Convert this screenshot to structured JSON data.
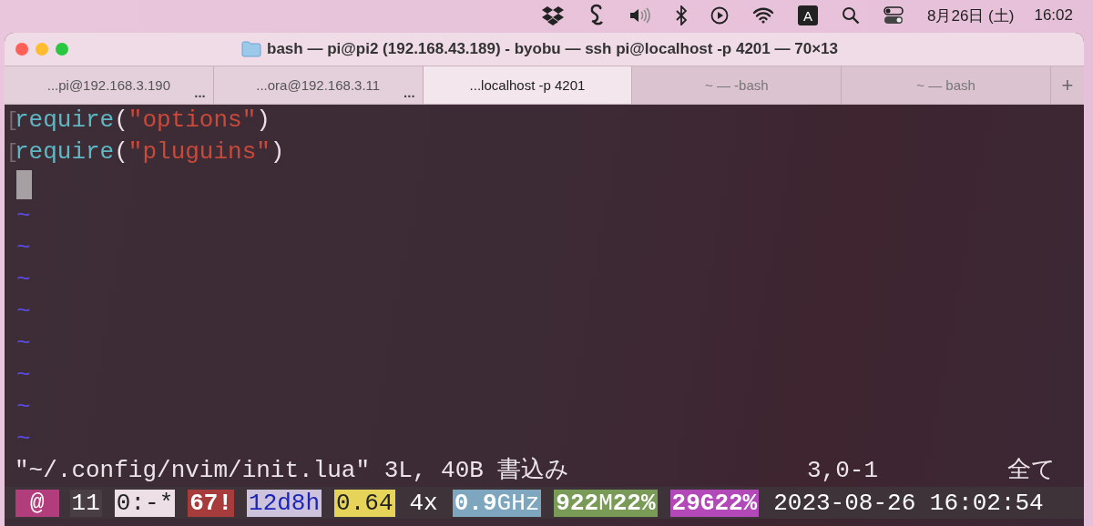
{
  "menu_bar": {
    "input_indicator": "A",
    "date": "8月26日 (土)",
    "time": "16:02"
  },
  "window": {
    "title": "bash — pi@pi2 (192.168.43.189) - byobu — ssh pi@localhost -p 4201 — 70×13"
  },
  "tabs": [
    {
      "label": "...pi@192.168.3.190",
      "selected": false,
      "more": "..."
    },
    {
      "label": "...ora@192.168.3.11",
      "selected": false,
      "more": "..."
    },
    {
      "label": "...localhost -p 4201",
      "selected": true
    },
    {
      "label": "~ — -bash",
      "selected": false
    },
    {
      "label": "~ — bash",
      "selected": false
    }
  ],
  "new_tab": "+",
  "editor": {
    "lines": [
      {
        "marker": "[",
        "segments": [
          {
            "kind": "function",
            "text": "require"
          },
          {
            "kind": "paren",
            "text": "("
          },
          {
            "kind": "string",
            "text": "\"options\""
          },
          {
            "kind": "paren",
            "text": ")"
          }
        ]
      },
      {
        "marker": "[",
        "segments": [
          {
            "kind": "function",
            "text": "require"
          },
          {
            "kind": "paren",
            "text": "("
          },
          {
            "kind": "string",
            "text": "\"pluguins\""
          },
          {
            "kind": "paren",
            "text": ")"
          }
        ]
      }
    ],
    "empty_lines": [
      "~",
      "~",
      "~",
      "~",
      "~",
      "~",
      "~",
      "~"
    ],
    "message": "\"~/.config/nvim/init.lua\" 3L, 40B 書込み",
    "position": "3,0-1",
    "scroll": "全て"
  },
  "status_bar": [
    {
      "text": "@",
      "color": "#b23d7d",
      "kind": "light"
    },
    {
      "text": "11",
      "color": "#4a3e45",
      "kind": "light"
    },
    {
      "text": "0:-*",
      "color": "#ece0e6",
      "kind": "dark"
    },
    {
      "text": "**67!**",
      "color": "#a73c3c",
      "kind": "light"
    },
    {
      "text": "12d8h",
      "color": "#cdc3dd",
      "kind": "blue"
    },
    {
      "text": "0.64",
      "color": "#e6d45a",
      "kind": "dark"
    },
    {
      "text": "4x",
      "color": "#3d3339",
      "kind": "light"
    },
    {
      "text": "**0.9**GHz",
      "color": "#7ea6bf",
      "kind": "light"
    },
    {
      "text": "**922**M**22%**",
      "color": "#7a9a58",
      "kind": "light"
    },
    {
      "text": "**29G22%**",
      "color": "#b348b8",
      "kind": "light"
    },
    {
      "text": "2023-08-26 16:02:54",
      "color": "#3d3339",
      "kind": "light"
    }
  ]
}
